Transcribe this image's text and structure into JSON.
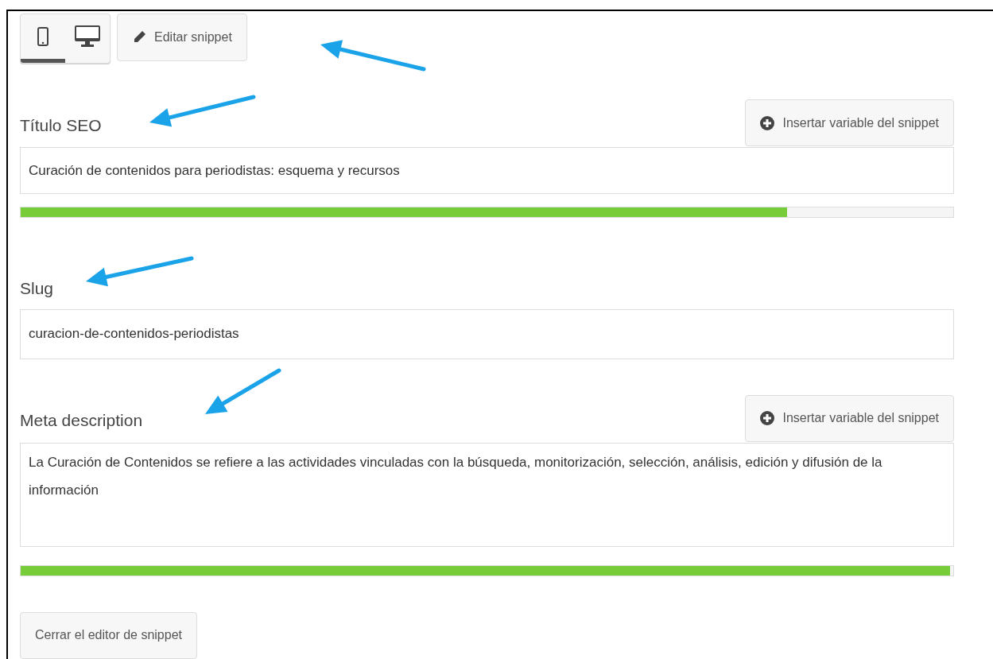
{
  "device_toggle": [
    {
      "kind": "mobile",
      "selected": true
    },
    {
      "kind": "desktop",
      "selected": false
    }
  ],
  "edit_button": {
    "label": "Editar snippet"
  },
  "fields": [
    {
      "kind": "input",
      "label": "Título SEO",
      "insert_button": "Insertar variable del snippet",
      "value": "Curación de contenidos para periodistas: esquema y recursos",
      "progress": {
        "level": 0.822
      }
    },
    {
      "kind": "input",
      "label": "Slug",
      "value": "curacion-de-contenidos-periodistas"
    },
    {
      "kind": "textarea",
      "label": "Meta description",
      "insert_button": "Insertar variable del snippet",
      "value": "La Curación de Contenidos se refiere a las actividades vinculadas con la búsqueda, monitorización, selección, análisis, edición y difusión de la información",
      "progress": {
        "level": 0.997
      }
    }
  ],
  "close_button": {
    "label": "Cerrar el editor de snippet"
  }
}
